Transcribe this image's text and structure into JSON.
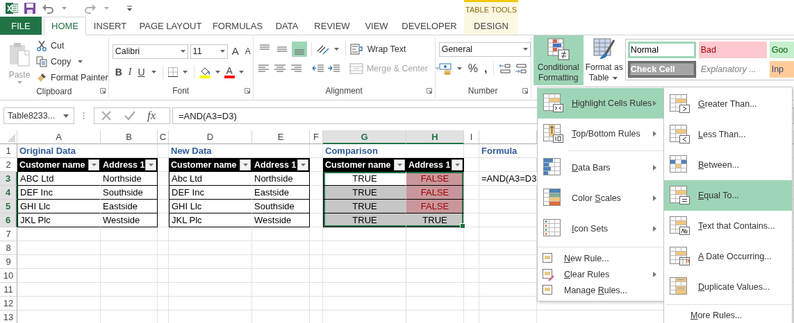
{
  "contextual_header": {
    "title": "TABLE TOOLS"
  },
  "tabs": [
    {
      "label": "FILE",
      "kind": "file",
      "selected": false
    },
    {
      "label": "HOME",
      "kind": "main",
      "selected": true
    },
    {
      "label": "INSERT",
      "kind": "main",
      "selected": false
    },
    {
      "label": "PAGE LAYOUT",
      "kind": "main",
      "selected": false
    },
    {
      "label": "FORMULAS",
      "kind": "main",
      "selected": false
    },
    {
      "label": "DATA",
      "kind": "main",
      "selected": false
    },
    {
      "label": "REVIEW",
      "kind": "main",
      "selected": false
    },
    {
      "label": "VIEW",
      "kind": "main",
      "selected": false
    },
    {
      "label": "DEVELOPER",
      "kind": "main",
      "selected": false
    },
    {
      "label": "DESIGN",
      "kind": "contextual",
      "selected": false
    }
  ],
  "clipboard": {
    "paste": "Paste",
    "cut": "Cut",
    "copy": "Copy",
    "format_painter": "Format Painter",
    "group_label": "Clipboard"
  },
  "font": {
    "name": "Calibri",
    "size": "11",
    "grow": "A",
    "shrink": "A",
    "bold": "B",
    "italic": "I",
    "underline": "U",
    "font_color": "A",
    "group_label": "Font"
  },
  "alignment": {
    "vertical_align": [
      {
        "kind": "top",
        "selected": false
      },
      {
        "kind": "middle",
        "selected": false
      },
      {
        "kind": "bottom",
        "selected": true
      }
    ],
    "wrap_text": "Wrap Text",
    "merge_center": {
      "label": "Merge & Center",
      "disabled": true
    },
    "group_label": "Alignment"
  },
  "number": {
    "format": "General",
    "percent": "%",
    "comma": ",",
    "group_label": "Number"
  },
  "styles": {
    "conditional_formatting": {
      "label": "Conditional Formatting",
      "selected": true
    },
    "format_as_table": "Format as Table",
    "cell_styles": [
      {
        "label": "Normal",
        "kind": "normal",
        "selected": true
      },
      {
        "label": "Bad",
        "kind": "bad",
        "selected": false
      },
      {
        "label": "Goo",
        "kind": "good",
        "selected": false
      },
      {
        "label": "Check Cell",
        "kind": "check",
        "selected": false
      },
      {
        "label": "Explanatory ...",
        "kind": "explanatory",
        "selected": false
      },
      {
        "label": "Inp",
        "kind": "input",
        "selected": false
      }
    ]
  },
  "formula_bar": {
    "name_box": "Table8233...",
    "function_label": "fx",
    "formula": "=AND(A3=D3)"
  },
  "sheet": {
    "columns": [
      {
        "label": "A",
        "selected": false
      },
      {
        "label": "B",
        "selected": false
      },
      {
        "label": "C",
        "selected": false
      },
      {
        "label": "D",
        "selected": false
      },
      {
        "label": "E",
        "selected": false
      },
      {
        "label": "F",
        "selected": false
      },
      {
        "label": "G",
        "selected": true
      },
      {
        "label": "H",
        "selected": true
      },
      {
        "label": "I",
        "selected": false
      }
    ],
    "rows": [
      {
        "label": "1",
        "selected": false
      },
      {
        "label": "2",
        "selected": false
      },
      {
        "label": "3",
        "selected": true
      },
      {
        "label": "4",
        "selected": true
      },
      {
        "label": "5",
        "selected": true
      },
      {
        "label": "6",
        "selected": true
      },
      {
        "label": "7",
        "selected": false
      },
      {
        "label": "8",
        "selected": false
      },
      {
        "label": "9",
        "selected": false
      },
      {
        "label": "10",
        "selected": false
      },
      {
        "label": "11",
        "selected": false
      },
      {
        "label": "12",
        "selected": false
      },
      {
        "label": "13",
        "selected": false
      }
    ],
    "tables": [
      {
        "kind": "values",
        "title": "Original Data",
        "columns": [
          "Customer name",
          "Address 1"
        ],
        "rows": [
          [
            "ABC Ltd",
            "Northside"
          ],
          [
            "DEF Inc",
            "Southside"
          ],
          [
            "GHI Llc",
            "Eastside"
          ],
          [
            "JKL Plc",
            "Westside"
          ]
        ]
      },
      {
        "kind": "values",
        "title": "New Data",
        "columns": [
          "Customer name",
          "Address 1"
        ],
        "rows": [
          [
            "Abc Ltd",
            "Northside"
          ],
          [
            "DEF Inc",
            "Eastside"
          ],
          [
            "GHI Llc",
            "Southside"
          ],
          [
            "JKL Plc",
            "Westside"
          ]
        ]
      },
      {
        "kind": "comparison",
        "title": "Comparison",
        "columns": [
          "Customer name",
          "Address 1"
        ],
        "rows": [
          [
            {
              "text": "TRUE",
              "highlight": false,
              "active": true
            },
            {
              "text": "FALSE",
              "highlight": true,
              "active": false
            }
          ],
          [
            {
              "text": "TRUE",
              "highlight": false,
              "active": false
            },
            {
              "text": "FALSE",
              "highlight": true,
              "active": false
            }
          ],
          [
            {
              "text": "TRUE",
              "highlight": false,
              "active": false
            },
            {
              "text": "FALSE",
              "highlight": true,
              "active": false
            }
          ],
          [
            {
              "text": "TRUE",
              "highlight": false,
              "active": false
            },
            {
              "text": "TRUE",
              "highlight": false,
              "active": false
            }
          ]
        ]
      }
    ],
    "note": {
      "title": "Formula",
      "formula": "=AND(A3=D3"
    }
  },
  "conditional_menu": {
    "items": [
      {
        "kind": "highlight_rules",
        "key": "H",
        "post": "ighlight Cells Rules",
        "has_submenu": true,
        "selected": true,
        "separator_before": false
      },
      {
        "kind": "top_bottom",
        "key": "T",
        "post": "op/Bottom Rules",
        "has_submenu": true,
        "selected": false,
        "separator_before": false
      },
      {
        "kind": "data_bars",
        "key": "D",
        "post": "ata Bars",
        "has_submenu": true,
        "selected": false,
        "separator_before": true
      },
      {
        "kind": "color_scales",
        "pre": "Color ",
        "key": "S",
        "post": "cales",
        "has_submenu": true,
        "selected": false,
        "separator_before": false
      },
      {
        "kind": "icon_sets",
        "key": "I",
        "post": "con Sets",
        "has_submenu": true,
        "selected": false,
        "separator_before": false
      },
      {
        "kind": "new_rule",
        "key": "N",
        "post": "ew Rule...",
        "has_submenu": false,
        "selected": false,
        "separator_before": true
      },
      {
        "kind": "clear_rules",
        "key": "C",
        "post": "lear Rules",
        "has_submenu": true,
        "selected": false,
        "separator_before": false
      },
      {
        "kind": "manage_rules",
        "pre": "Manage ",
        "key": "R",
        "post": "ules...",
        "has_submenu": false,
        "selected": false,
        "separator_before": false
      }
    ]
  },
  "highlight_submenu": {
    "items": [
      {
        "kind": "greater",
        "key": "G",
        "post": "reater Than...",
        "selected": false,
        "separator_before": false
      },
      {
        "kind": "less",
        "key": "L",
        "post": "ess Than...",
        "selected": false,
        "separator_before": false
      },
      {
        "kind": "between",
        "key": "B",
        "post": "etween...",
        "selected": false,
        "separator_before": false
      },
      {
        "kind": "equal",
        "key": "E",
        "post": "qual To...",
        "selected": true,
        "separator_before": false
      },
      {
        "kind": "text_contains",
        "key": "T",
        "post": "ext that Contains...",
        "selected": false,
        "separator_before": false
      },
      {
        "kind": "date",
        "key": "A",
        "post": " Date Occurring...",
        "selected": false,
        "separator_before": false
      },
      {
        "kind": "duplicate",
        "key": "D",
        "post": "uplicate Values...",
        "selected": false,
        "separator_before": false
      },
      {
        "kind": "more",
        "key": "M",
        "post": "ore Rules...",
        "selected": false,
        "separator_before": true
      }
    ]
  }
}
